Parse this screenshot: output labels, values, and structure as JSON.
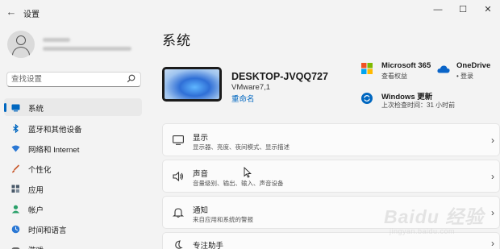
{
  "app": {
    "title": "设置",
    "back_glyph": "←"
  },
  "window_controls": {
    "minimize": "—",
    "maximize": "☐",
    "close": "✕"
  },
  "search": {
    "placeholder": "查找设置",
    "icon": "search-icon"
  },
  "sidebar": {
    "items": [
      {
        "label": "系统",
        "icon": "display-icon",
        "color": "#0067c0",
        "active": true
      },
      {
        "label": "蓝牙和其他设备",
        "icon": "bluetooth-icon",
        "color": "#0067c0"
      },
      {
        "label": "网络和 Internet",
        "icon": "wifi-icon",
        "color": "#2b78d4"
      },
      {
        "label": "个性化",
        "icon": "brush-icon",
        "color": "#c8592c"
      },
      {
        "label": "应用",
        "icon": "apps-icon",
        "color": "#4a5a6a"
      },
      {
        "label": "帐户",
        "icon": "account-icon",
        "color": "#2aa06a"
      },
      {
        "label": "时间和语言",
        "icon": "globe-clock-icon",
        "color": "#2b78d4"
      },
      {
        "label": "游戏",
        "icon": "game-icon",
        "color": "#6b6b6b"
      }
    ]
  },
  "page": {
    "title": "系统"
  },
  "device": {
    "name": "DESKTOP-JVQQ727",
    "model": "VMware7,1",
    "rename_label": "重命名"
  },
  "quick": {
    "m365": {
      "title": "Microsoft 365",
      "sub": "查看权益"
    },
    "onedrive": {
      "title": "OneDrive",
      "sub": "• 登录"
    },
    "update": {
      "title": "Windows 更新",
      "sub": "上次检查时间：31 小时前"
    }
  },
  "cards": [
    {
      "title": "显示",
      "sub": "显示器、亮度、夜间模式、显示描述",
      "icon": "monitor-icon"
    },
    {
      "title": "声音",
      "sub": "音量级别、输出、输入、声音设备",
      "icon": "speaker-icon"
    },
    {
      "title": "通知",
      "sub": "来自应用和系统的警报",
      "icon": "bell-icon"
    },
    {
      "title": "专注助手",
      "sub": "",
      "icon": "moon-icon"
    }
  ],
  "watermark": {
    "main": "Baidu 经验",
    "sub": "jingyan.baidu.com"
  },
  "colors": {
    "accent": "#0067c0",
    "background": "#f3f3f3",
    "card": "#fbfbfb"
  }
}
